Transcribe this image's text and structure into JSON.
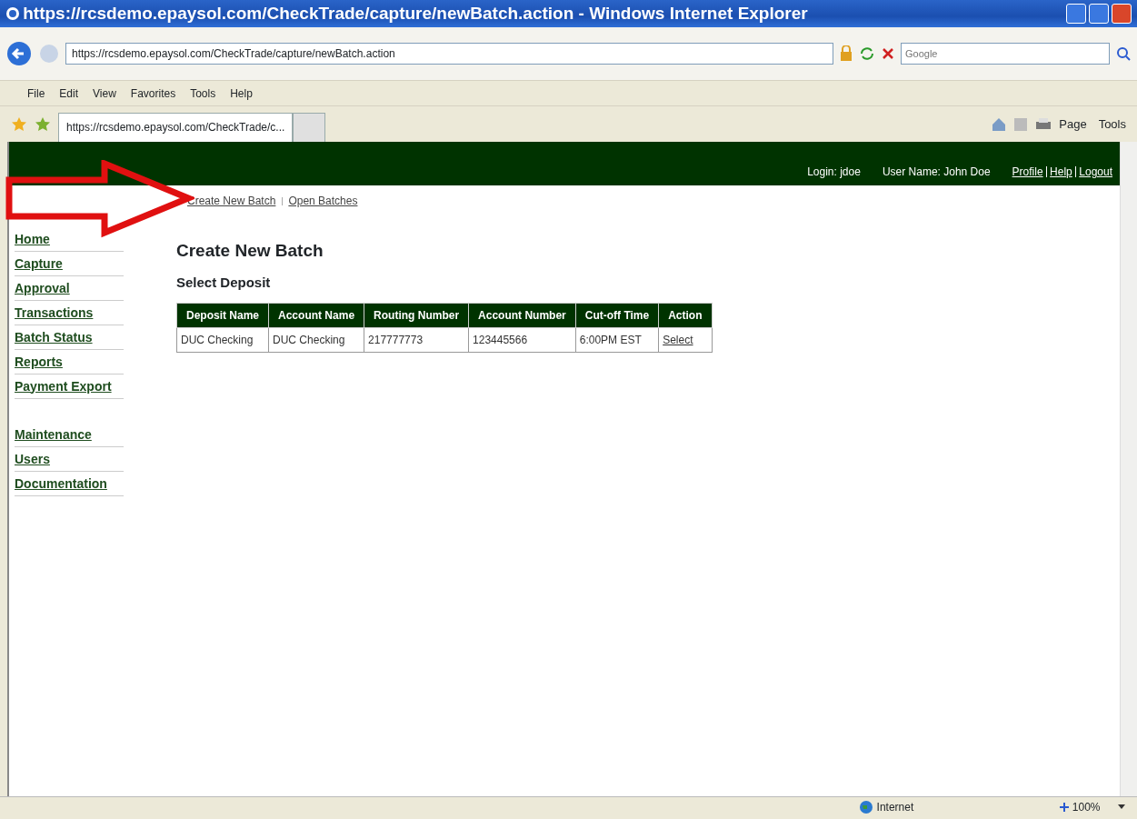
{
  "window": {
    "title": "https://rcsdemo.epaysol.com/CheckTrade/capture/newBatch.action - Windows Internet Explorer"
  },
  "address_bar": {
    "url": "https://rcsdemo.epaysol.com/CheckTrade/capture/newBatch.action"
  },
  "search": {
    "placeholder": "Google"
  },
  "menu": [
    "File",
    "Edit",
    "View",
    "Favorites",
    "Tools",
    "Help"
  ],
  "tabs": [
    {
      "label": "https://rcsdemo.epaysol.com/CheckTrade/c...",
      "selected": true
    }
  ],
  "command_bar": [
    "Page",
    "Tools"
  ],
  "header": {
    "login": "Login: jdoe",
    "user_name": "User Name: John Doe",
    "links": [
      "Profile",
      "Help",
      "Logout"
    ]
  },
  "subnav": [
    "Create New Batch",
    "Open Batches"
  ],
  "sidebar": {
    "groups": [
      [
        "Home",
        "Capture",
        "Approval",
        "Transactions",
        "Batch Status",
        "Reports",
        "Payment Export"
      ],
      [
        "Maintenance",
        "Users",
        "Documentation"
      ]
    ]
  },
  "page_title": "Create New Batch",
  "section_title": "Select Deposit",
  "table": {
    "columns": [
      "Deposit Name",
      "Account Name",
      "Routing Number",
      "Account Number",
      "Cut-off Time",
      "Action"
    ],
    "rows": [
      {
        "cells": [
          "DUC Checking",
          "DUC Checking",
          "217777773",
          "123445566",
          "6:00PM EST"
        ],
        "action": "Select"
      }
    ]
  },
  "status_bar": {
    "zone": "Internet",
    "zoom": "100%"
  }
}
